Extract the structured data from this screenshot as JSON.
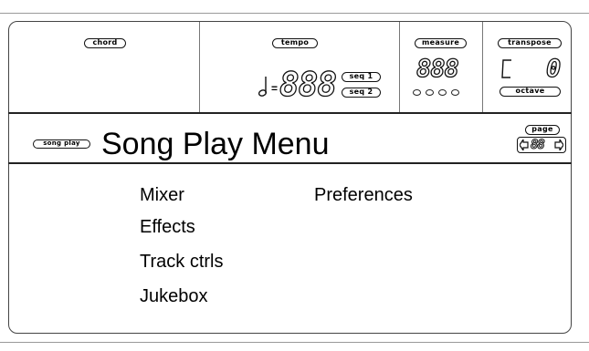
{
  "header": {
    "chord_label": "chord",
    "tempo_label": "tempo",
    "tempo_value": "888",
    "seq1_label": "seq 1",
    "seq2_label": "seq 2",
    "measure_label": "measure",
    "measure_value": "888",
    "transpose_label": "transpose",
    "transpose_value": "0",
    "octave_label": "octave"
  },
  "title_bar": {
    "mode_label": "song play",
    "title": "Song Play Menu",
    "page_label": "page",
    "page_value": "88"
  },
  "menu": {
    "col1": [
      "Mixer",
      "Effects",
      "Track ctrls",
      "Jukebox"
    ],
    "col2": [
      "Preferences"
    ]
  }
}
